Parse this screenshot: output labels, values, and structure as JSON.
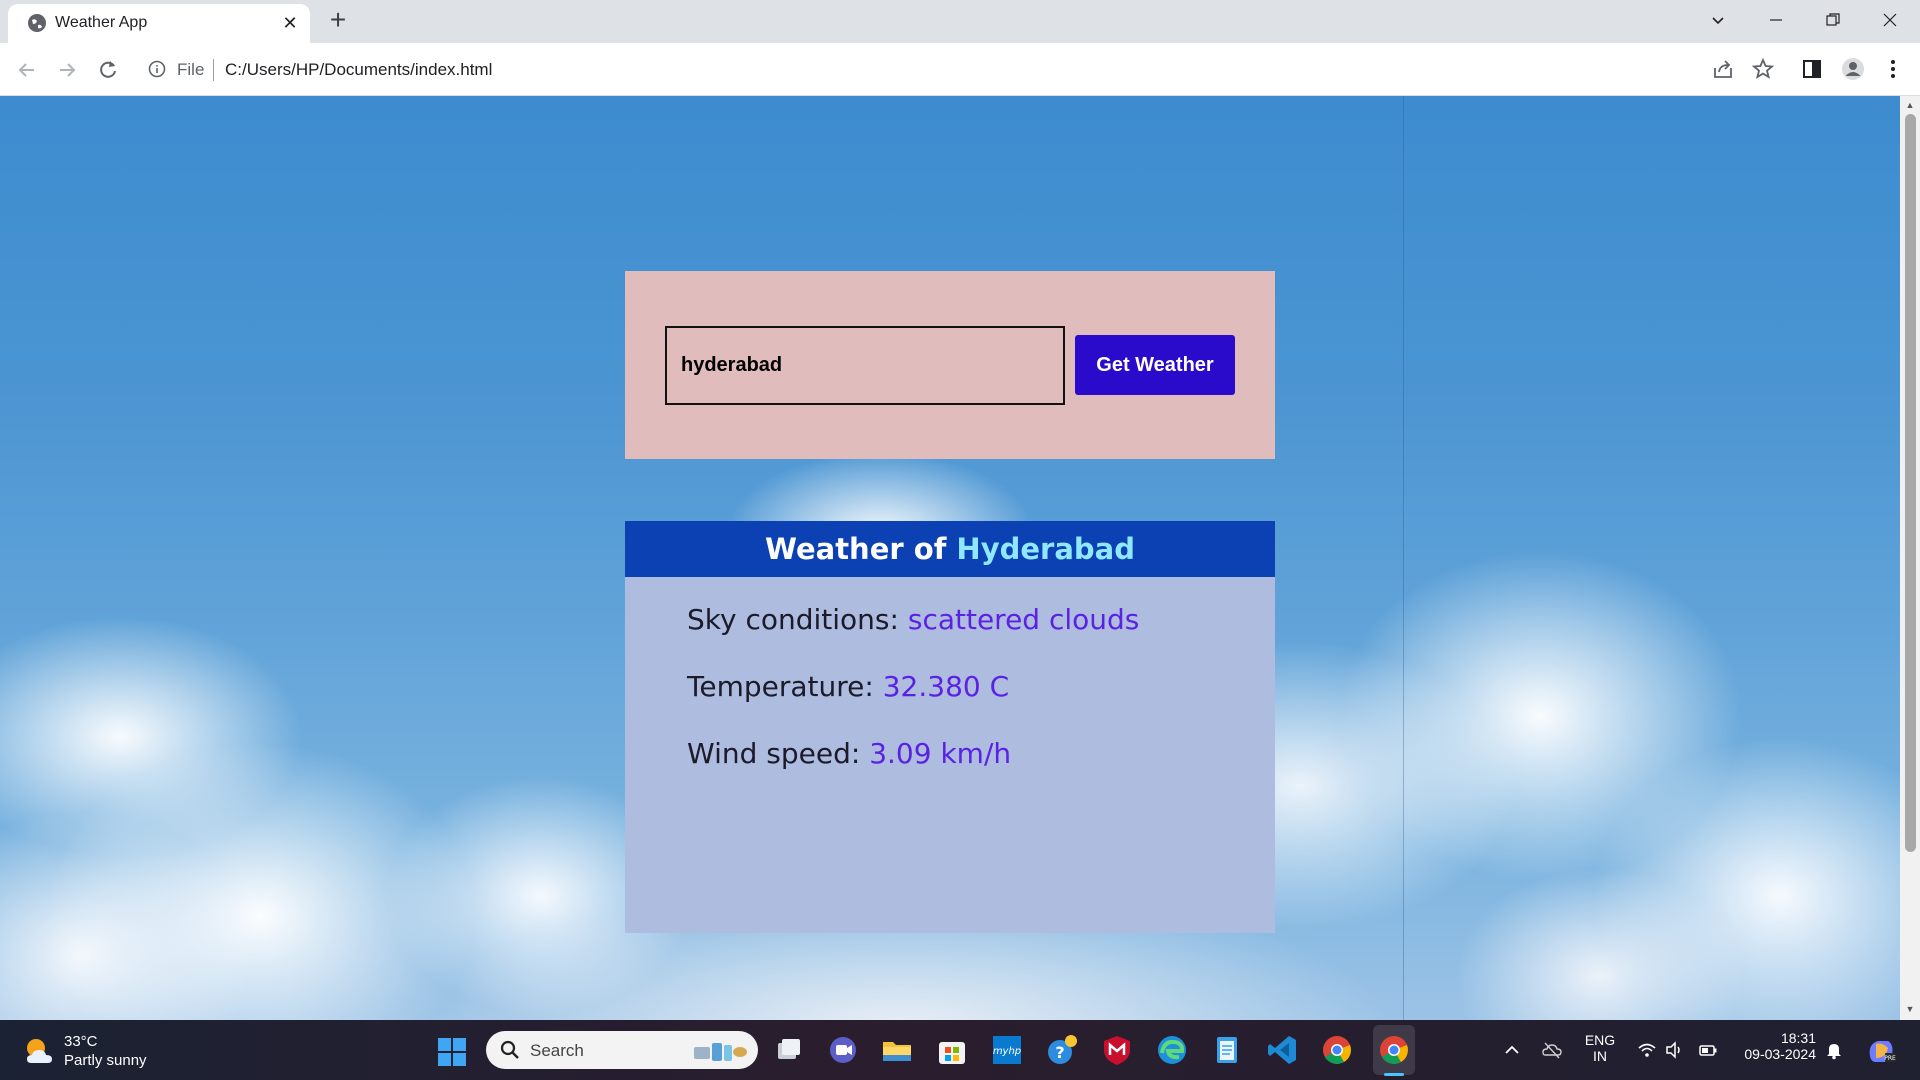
{
  "browser": {
    "tab_title": "Weather App",
    "new_tab_symbol": "+",
    "close_symbol": "✕",
    "address_scheme_label": "File",
    "address_url": "C:/Users/HP/Documents/index.html"
  },
  "page": {
    "search": {
      "city_value": "hyderabad",
      "button_label": "Get Weather"
    },
    "weather": {
      "header_prefix": "Weather of",
      "city": "Hyderabad",
      "sky_label": "Sky conditions:",
      "sky_value": "scattered clouds",
      "temp_label": "Temperature:",
      "temp_value": "32.380 C",
      "wind_label": "Wind speed:",
      "wind_value": "3.09 km/h"
    }
  },
  "taskbar": {
    "weather_temp": "33°C",
    "weather_desc": "Partly sunny",
    "search_placeholder": "Search",
    "language_top": "ENG",
    "language_bottom": "IN",
    "time": "18:31",
    "date": "09-03-2024",
    "apps": [
      "task-view",
      "meet",
      "file-explorer",
      "microsoft-store",
      "myhp",
      "get-help",
      "mcafee",
      "edge",
      "notepad",
      "vscode",
      "chrome",
      "chrome-active"
    ]
  },
  "colors": {
    "search_card_bg": "#e1bcbc",
    "button_bg": "#2a0acb",
    "weather_header_bg": "#0c41b3",
    "weather_city_color": "#8fe8ff",
    "weather_body_bg": "#aebce0",
    "value_color": "#5b22e3"
  }
}
